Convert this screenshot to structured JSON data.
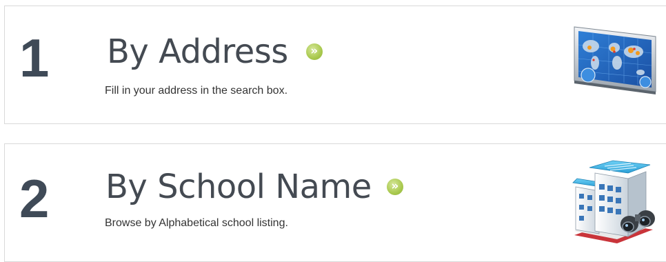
{
  "options": [
    {
      "number": "1",
      "title": "By Address",
      "description": "Fill in your address in the search box.",
      "icon": "world-map-display-icon"
    },
    {
      "number": "2",
      "title": "By School Name",
      "description": "Browse by Alphabetical school listing.",
      "icon": "school-building-binoculars-icon"
    }
  ],
  "colors": {
    "number_text": "#3f4a57",
    "title_text": "#444a52",
    "arrow_green": "#a9c94e",
    "card_border": "#d9d9d9"
  }
}
